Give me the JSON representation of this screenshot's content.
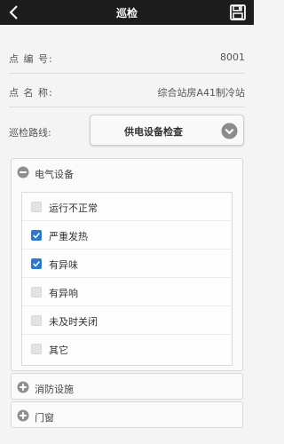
{
  "header": {
    "title": "巡检",
    "back_icon": "back-chevron-icon",
    "save_icon": "save-disk-icon"
  },
  "info": {
    "point_no_label": "点 编 号:",
    "point_no_value": "8001",
    "point_name_label": "点 名 称:",
    "point_name_value": "综合站房A41制冷站"
  },
  "route": {
    "label": "巡检路线:",
    "selected": "供电设备检查"
  },
  "sections": [
    {
      "title": "电气设备",
      "expanded": true,
      "items": [
        {
          "label": "运行不正常",
          "checked": false
        },
        {
          "label": "严重发热",
          "checked": true
        },
        {
          "label": "有异味",
          "checked": true
        },
        {
          "label": "有异响",
          "checked": false
        },
        {
          "label": "未及时关闭",
          "checked": false
        },
        {
          "label": "其它",
          "checked": false
        }
      ]
    },
    {
      "title": "消防设施",
      "expanded": false
    },
    {
      "title": "门窗",
      "expanded": false
    }
  ],
  "colors": {
    "topbar": "#1d1d1d",
    "checkbox_checked": "#2d78c8",
    "background": "#f4f4f4"
  }
}
